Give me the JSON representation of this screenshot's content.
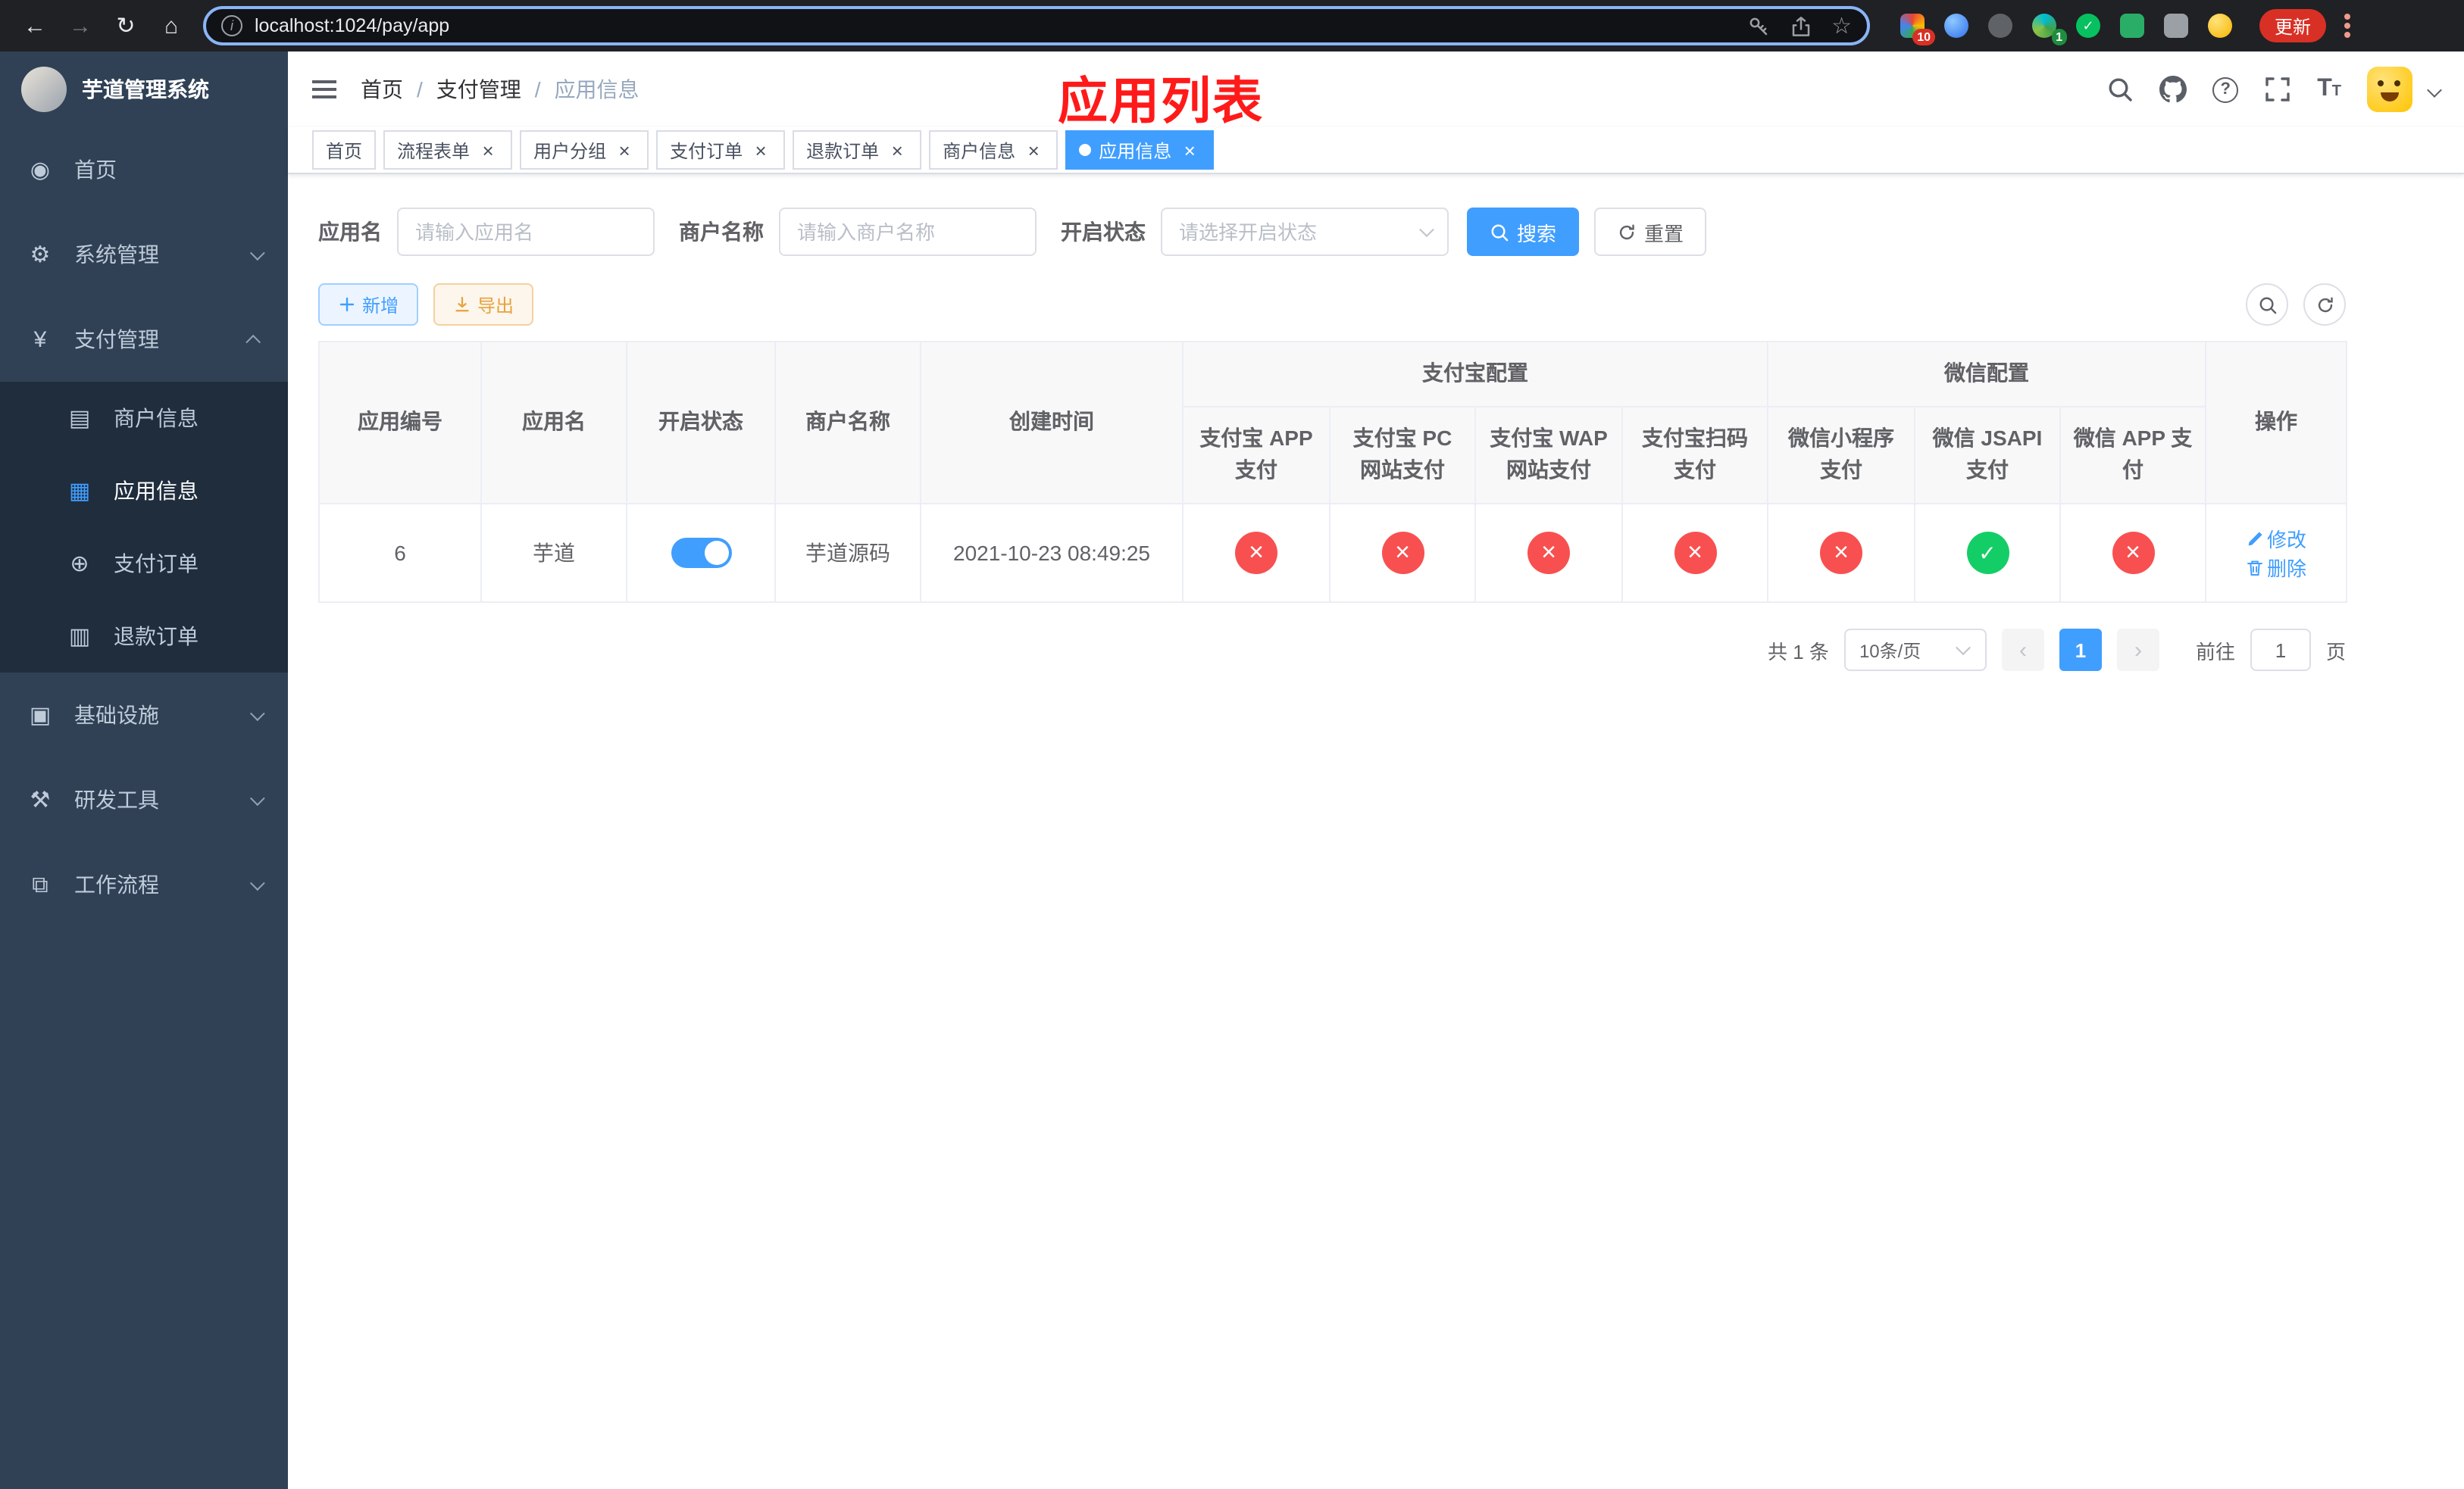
{
  "colors": {
    "primary": "#409eff",
    "success": "#13ce66",
    "danger": "#f85050",
    "warning": "#e6a23c",
    "annotation": "#ff1a1a",
    "sidebar_bg": "#304156",
    "submenu_bg": "#1f2d3d",
    "sidebar_text": "#bfcbd9",
    "chrome_bg": "#202124",
    "chrome_accent": "#8ab4f8",
    "update_red": "#d93025"
  },
  "browser": {
    "url": "localhost:1024/pay/app",
    "update_label": "更新",
    "ext_badge_grid": "10",
    "ext_badge_translate": "1"
  },
  "sidebar": {
    "title": "芋道管理系统",
    "items": {
      "home": "首页",
      "system": "系统管理",
      "payment": "支付管理",
      "merchant": "商户信息",
      "app": "应用信息",
      "order": "支付订单",
      "refund": "退款订单",
      "infra": "基础设施",
      "devtools": "研发工具",
      "workflow": "工作流程"
    }
  },
  "header": {
    "breadcrumb": {
      "home": "首页",
      "section": "支付管理",
      "current": "应用信息"
    },
    "annotation": "应用列表"
  },
  "tabs": [
    {
      "label": "首页"
    },
    {
      "label": "流程表单"
    },
    {
      "label": "用户分组"
    },
    {
      "label": "支付订单"
    },
    {
      "label": "退款订单"
    },
    {
      "label": "商户信息"
    },
    {
      "label": "应用信息"
    }
  ],
  "filters": {
    "app_name_label": "应用名",
    "app_name_placeholder": "请输入应用名",
    "merchant_label": "商户名称",
    "merchant_placeholder": "请输入商户名称",
    "status_label": "开启状态",
    "status_placeholder": "请选择开启状态",
    "search_label": "搜索",
    "reset_label": "重置"
  },
  "toolbar": {
    "add_label": "新增",
    "export_label": "导出"
  },
  "table": {
    "col_app_id": "应用编号",
    "col_app_name": "应用名",
    "col_status": "开启状态",
    "col_merchant": "商户名称",
    "col_created": "创建时间",
    "group_alipay": "支付宝配置",
    "group_wechat": "微信配置",
    "col_alipay_app": "支付宝 APP 支付",
    "col_alipay_pc": "支付宝 PC 网站支付",
    "col_alipay_wap": "支付宝 WAP 网站支付",
    "col_alipay_qr": "支付宝扫码支付",
    "col_wx_lite": "微信小程序支付",
    "col_wx_jsapi": "微信 JSAPI 支付",
    "col_wx_app": "微信 APP 支付",
    "col_actions": "操作",
    "row": {
      "id": "6",
      "name": "芋道",
      "enabled": true,
      "merchant": "芋道源码",
      "created": "2021-10-23 08:49:25",
      "configs": {
        "alipay_app": false,
        "alipay_pc": false,
        "alipay_wap": false,
        "alipay_qr": false,
        "wx_lite": false,
        "wx_jsapi": true,
        "wx_app": false
      },
      "edit_label": "修改",
      "delete_label": "删除"
    }
  },
  "pagination": {
    "total": "共 1 条",
    "page_size": "10条/页",
    "page": "1",
    "goto_label": "前往",
    "goto_value": "1",
    "unit_label": "页"
  }
}
